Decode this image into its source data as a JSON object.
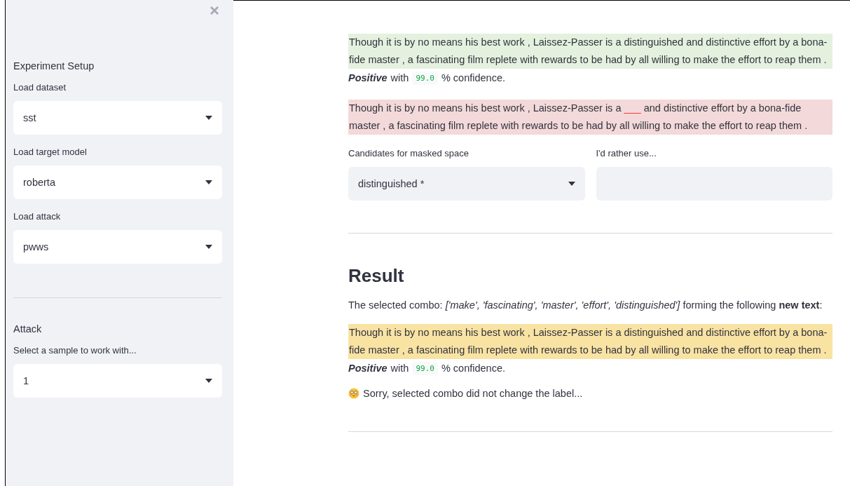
{
  "sidebar": {
    "sections": [
      {
        "title": "Experiment Setup",
        "selects": [
          {
            "label": "Load dataset",
            "value": "sst"
          },
          {
            "label": "Load target model",
            "value": "roberta"
          },
          {
            "label": "Load attack",
            "value": "pwws"
          }
        ]
      },
      {
        "title": "Attack",
        "selects": [
          {
            "label": "Select a sample to work with...",
            "value": "1"
          }
        ]
      }
    ]
  },
  "original": {
    "text": "Though it is by no means his best work , Laissez-Passer is a distinguished and distinctive effort by a bona-fide master , a fascinating film replete with rewards to be had by all willing to make the effort to reap them .",
    "prediction": {
      "label": "Positive",
      "connector": "with",
      "confidence": "99.0",
      "suffix": "% confidence."
    }
  },
  "masked": {
    "before": "Though it is by no means his best work , Laissez-Passer is a",
    "mask": "___",
    "after": "and distinctive effort by a bona-fide master , a fascinating film replete with rewards to be had by all willing to make the effort to reap them ."
  },
  "candidates": {
    "label": "Candidates for masked space",
    "value": "distinguished *"
  },
  "custom_word": {
    "label": "I'd rather use..."
  },
  "result": {
    "heading": "Result",
    "combo": "The selected combo: *['make', 'fascinating', 'master', 'effort', 'distinguished']* forming the following **new text**:",
    "text": "Though it is by no means his best work , Laissez-Passer is a distinguished and distinctive effort by a bona-fide master , a fascinating film replete with rewards to be had by all willing to make the effort to reap them .",
    "prediction": {
      "label": "Positive",
      "connector": "with",
      "confidence": "99.0",
      "suffix": "% confidence."
    },
    "message": "Sorry, selected combo did not change the label..."
  }
}
